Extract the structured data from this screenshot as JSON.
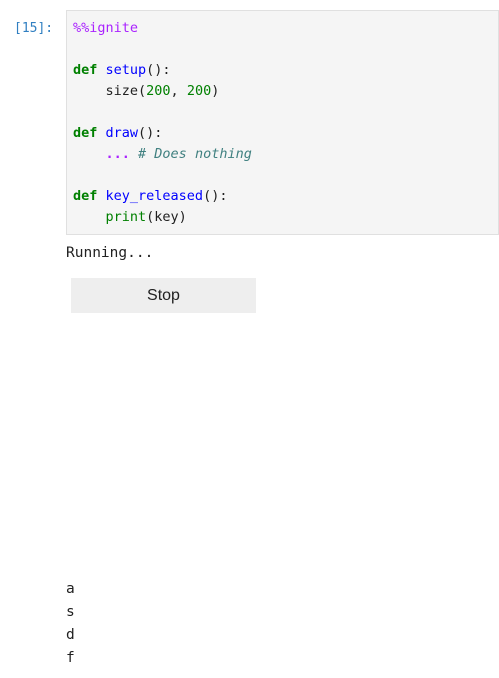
{
  "cell": {
    "prompt": "[15]:",
    "code": {
      "magic": "%%ignite",
      "def_kw": "def",
      "setup_name": "setup",
      "setup_parens": "():",
      "size_call": "size(",
      "size_w": "200",
      "size_sep": ", ",
      "size_h": "200",
      "size_close": ")",
      "draw_name": "draw",
      "draw_parens": "():",
      "ellipsis": "...",
      "comment": "# Does nothing",
      "key_name": "key_released",
      "key_parens": "():",
      "print_name": "print",
      "print_args": "(key)"
    }
  },
  "output": {
    "status": "Running...",
    "stop_label": "Stop",
    "printed_keys": [
      "a",
      "s",
      "d",
      "f"
    ]
  }
}
